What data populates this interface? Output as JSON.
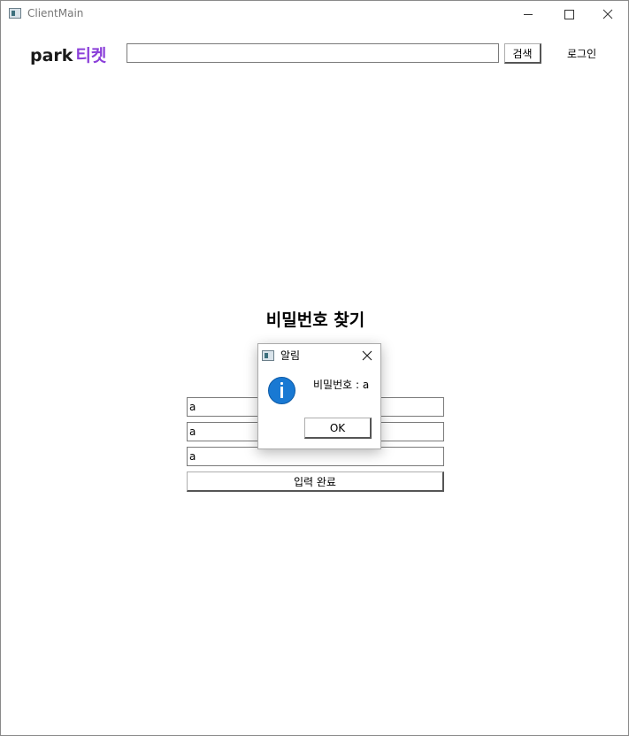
{
  "window": {
    "title": "ClientMain"
  },
  "header": {
    "logo_park": "park",
    "logo_ticket": "티켓",
    "search_value": "",
    "search_button": "검색",
    "login_label": "로그인"
  },
  "main": {
    "title": "비밀번호 찾기",
    "fields": [
      "a",
      "a",
      "a"
    ],
    "submit_label": "입력 완료"
  },
  "dialog": {
    "title": "알림",
    "message": "비밀번호 : a",
    "ok_label": "OK",
    "icon": "info-icon"
  },
  "colors": {
    "brand_accent": "#8b3fd9",
    "info_blue": "#1979d3"
  }
}
